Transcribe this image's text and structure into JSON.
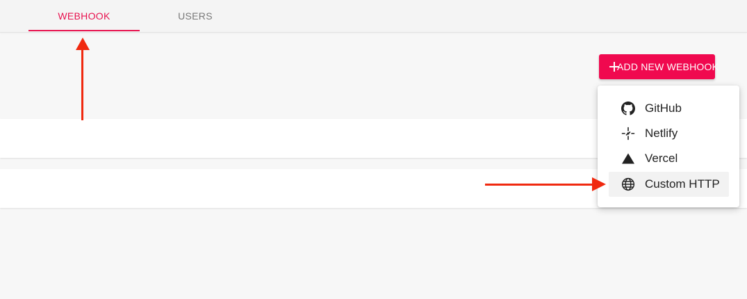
{
  "tabs": [
    {
      "label": "WEBHOOK",
      "active": true
    },
    {
      "label": "USERS",
      "active": false
    }
  ],
  "add_button": {
    "label": "ADD NEW WEBHOOK",
    "icon": "plus-icon"
  },
  "menu": {
    "items": [
      {
        "label": "GitHub",
        "icon": "github-icon"
      },
      {
        "label": "Netlify",
        "icon": "netlify-icon"
      },
      {
        "label": "Vercel",
        "icon": "vercel-icon"
      },
      {
        "label": "Custom HTTP",
        "icon": "globe-icon",
        "highlighted": true
      }
    ]
  },
  "colors": {
    "accent": "#e8124f",
    "button_bg": "#f0094f",
    "annotation": "#f0290f",
    "background": "#f7f7f7"
  }
}
